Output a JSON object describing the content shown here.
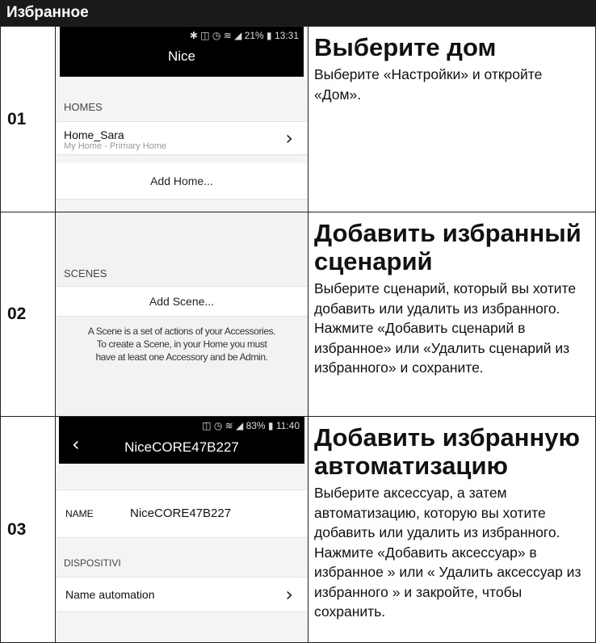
{
  "header": {
    "title": "Избранное"
  },
  "steps": [
    {
      "number": "01",
      "heading": "Выберите дом",
      "body": "Выберите «Настройки» и откройте «Дом».",
      "screen": {
        "status": "✱ ◫ ◷ ≋ ◢ 21% ▮ 13:31",
        "app_title": "Nice",
        "section": "HOMES",
        "home_name": "Home_Sara",
        "home_sub": "My Home - Primary Home",
        "add_label": "Add Home..."
      }
    },
    {
      "number": "02",
      "heading": "Добавить избранный сценарий",
      "body": "Выберите сценарий, который вы хотите добавить или удалить из избранного. Нажмите «Добавить сценарий в избранное» или «Удалить сценарий из избранного» и сохраните.",
      "screen": {
        "section": "SCENES",
        "add_label": "Add Scene...",
        "note_1": "A Scene is a set of actions of your Accessories.",
        "note_2": "To create a Scene, in your Home you must",
        "note_3": "have at least one Accessory and be Admin."
      }
    },
    {
      "number": "03",
      "heading": "Добавить избранную автоматизацию",
      "body": "Выберите аксессуар, а затем автоматизацию, которую вы хотите добавить или удалить из избранного. Нажмите «Добавить аксессуар» в избранное » или « Удалить аксессуар из избранного » и закройте, чтобы сохранить.",
      "screen": {
        "status": "◫ ◷ ≋ ◢ 83% ▮ 11:40",
        "title": "NiceCORE47B227",
        "name_key": "NAME",
        "name_value": "NiceCORE47B227",
        "section": "DISPOSITIVI",
        "row_label": "Name automation"
      }
    }
  ]
}
